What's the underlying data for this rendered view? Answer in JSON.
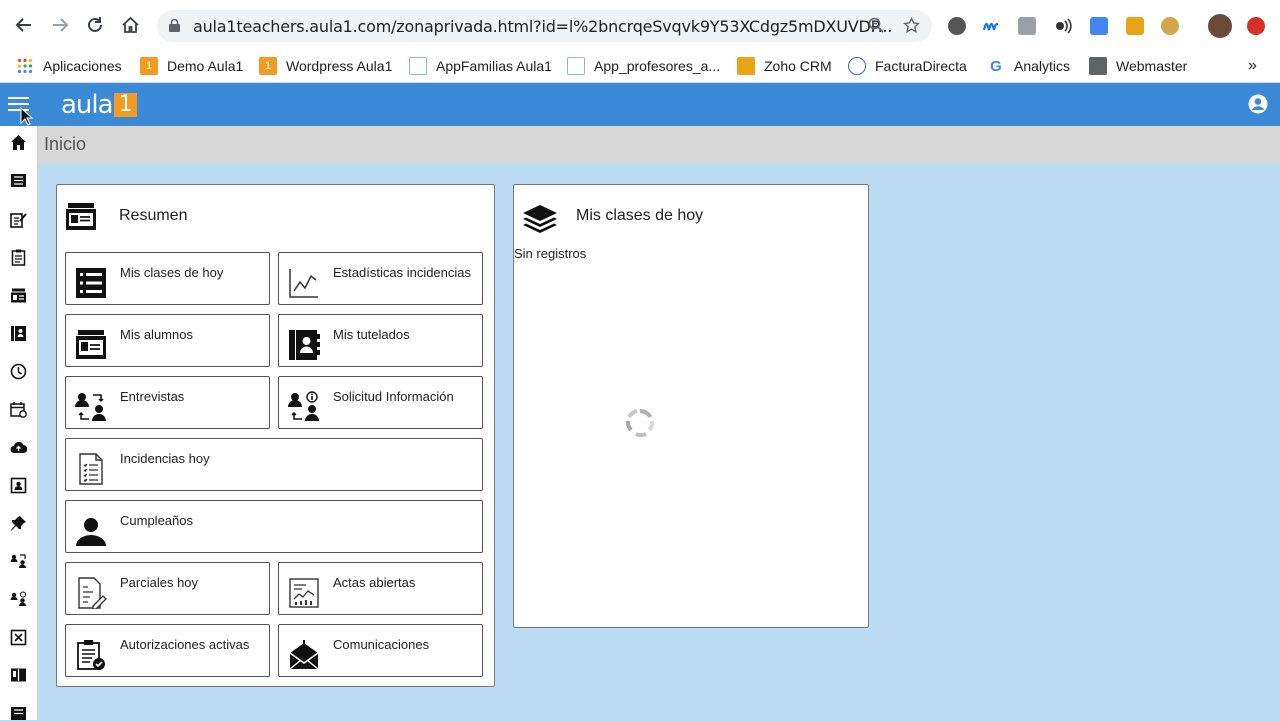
{
  "browser": {
    "url": "aula1teachers.aula1.com/zonaprivada.html?id=l%2bncrqeSvqvk9Y53XCdgz5mDXUVDP...",
    "bookmarks": [
      {
        "label": "Aplicaciones",
        "icon": "apps-grid-icon",
        "color": "#ea4335"
      },
      {
        "label": "Demo Aula1",
        "icon": "aula1-bookmark-icon",
        "color": "#f39a22"
      },
      {
        "label": "Wordpress Aula1",
        "icon": "aula1-bookmark-icon",
        "color": "#f39a22"
      },
      {
        "label": "AppFamilias Aula1",
        "icon": "document-bookmark-icon",
        "color": "#8ab4f8"
      },
      {
        "label": "App_profesores_a...",
        "icon": "document-bookmark-icon",
        "color": "#8ab4f8"
      },
      {
        "label": "Zoho CRM",
        "icon": "zoho-icon",
        "color": "#e8a317"
      },
      {
        "label": "FacturaDirecta",
        "icon": "factura-icon",
        "color": "#3367d6"
      },
      {
        "label": "Analytics",
        "icon": "google-icon",
        "color": "#4285f4"
      },
      {
        "label": "Webmaster",
        "icon": "webmaster-icon",
        "color": "#5f6368"
      }
    ],
    "bookmarks_overflow": "»"
  },
  "app": {
    "logo_text": "aula",
    "logo_badge": "1",
    "accent": "#3b8ad8",
    "page_title": "Inicio"
  },
  "resumen": {
    "title": "Resumen",
    "tiles": [
      {
        "label": "Mis clases de hoy",
        "icon": "list-icon"
      },
      {
        "label": "Estadísticas incidencias",
        "icon": "line-chart-icon"
      },
      {
        "label": "Mis alumnos",
        "icon": "student-id-icon"
      },
      {
        "label": "Mis tutelados",
        "icon": "contacts-book-icon"
      },
      {
        "label": "Entrevistas",
        "icon": "interview-icon"
      },
      {
        "label": "Solicitud Información",
        "icon": "info-request-icon"
      },
      {
        "label": "Incidencias hoy",
        "icon": "checklist-icon"
      },
      {
        "label": "Cumpleaños",
        "icon": "person-icon"
      },
      {
        "label": "Parciales hoy",
        "icon": "exam-icon"
      },
      {
        "label": "Actas abiertas",
        "icon": "report-chart-icon"
      },
      {
        "label": "Autorizaciones activas",
        "icon": "clipboard-check-icon"
      },
      {
        "label": "Comunicaciones",
        "icon": "mail-open-icon"
      }
    ]
  },
  "clases": {
    "title": "Mis clases de hoy",
    "empty_text": "Sin registros"
  }
}
